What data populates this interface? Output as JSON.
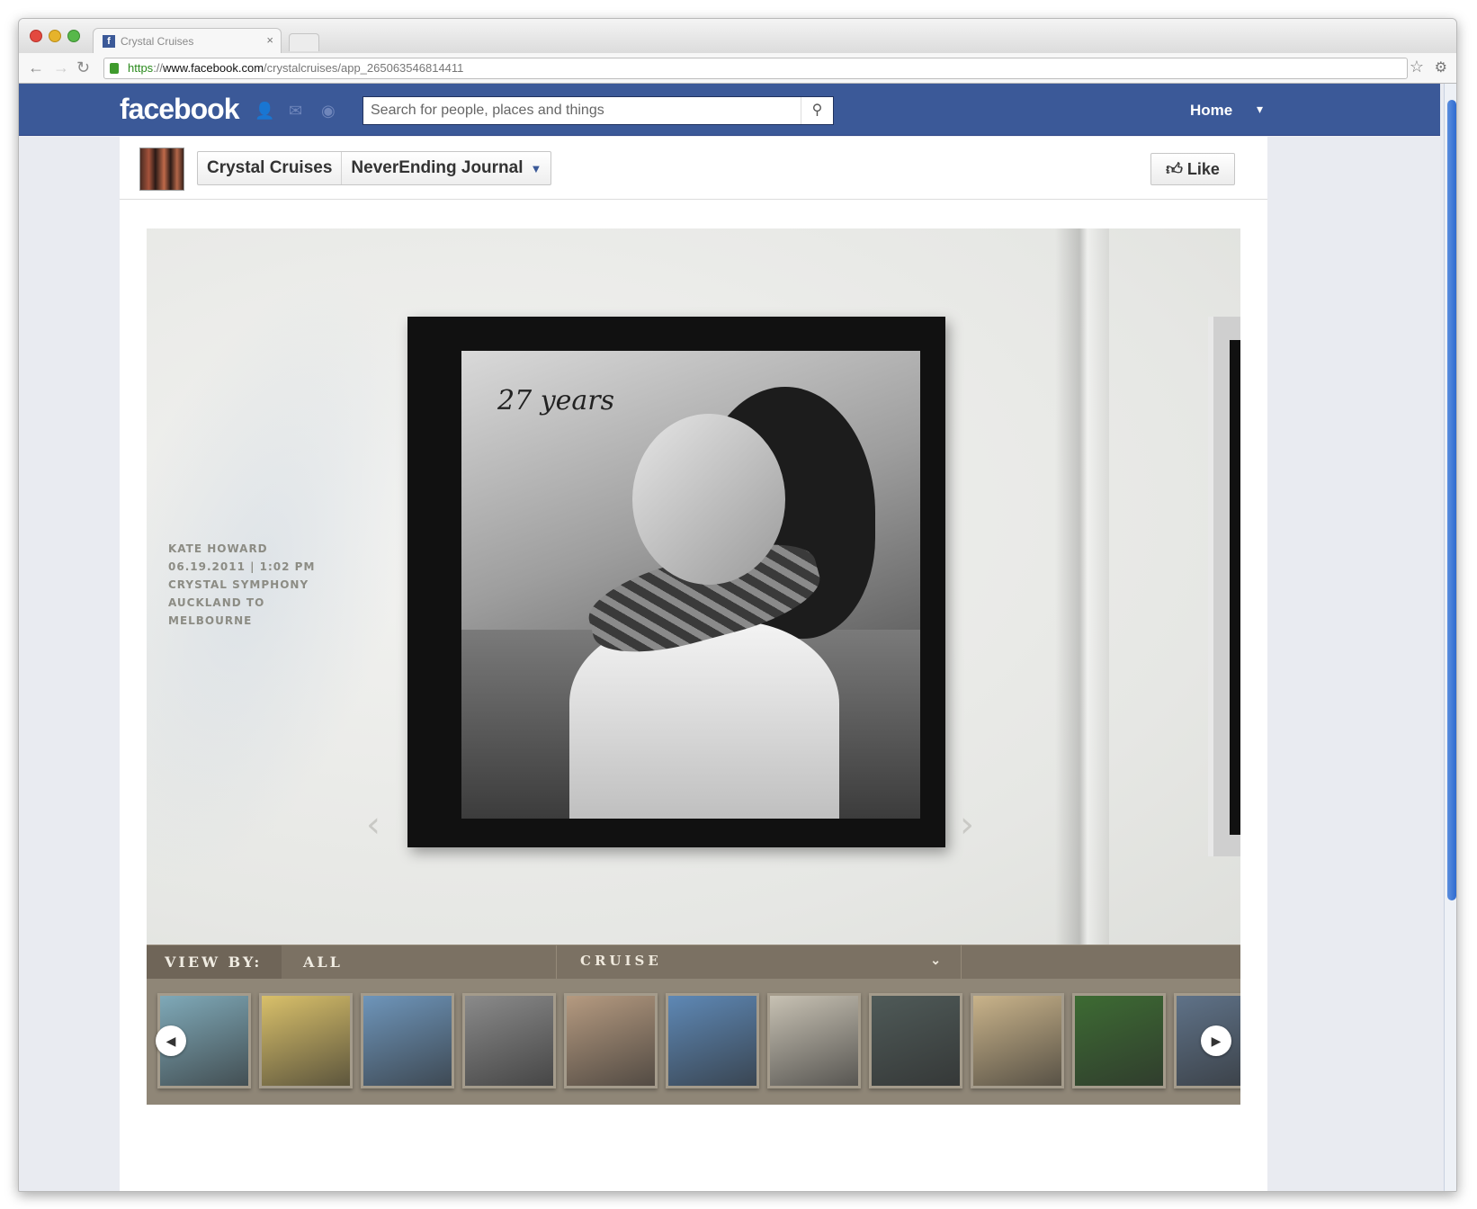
{
  "browser": {
    "tab_title": "Crystal Cruises",
    "tab_close": "×",
    "url_https": "https",
    "url_sep": "://",
    "url_domain": "www.facebook.com",
    "url_path": "/crystalcruises/app_265063546814411",
    "back": "←",
    "forward": "→",
    "reload": "↻",
    "star": "☆",
    "wrench": "🔧"
  },
  "facebook": {
    "logo": "facebook",
    "search_placeholder": "Search for people, places and things",
    "home": "Home",
    "caret": "▾"
  },
  "page": {
    "name": "Crystal Cruises",
    "app": "NeverEnding Journal",
    "like": "Like"
  },
  "journal": {
    "caption_lines": [
      "KATE HOWARD",
      "06.19.2011 | 1:02 PM",
      "CRYSTAL SYMPHONY",
      "AUCKLAND TO",
      "MELBOURNE"
    ],
    "photo_script": "27 years",
    "prev_arrow": "‹",
    "next_arrow": "›"
  },
  "viewby": {
    "label": "VIEW BY:",
    "all": "ALL",
    "cruise": "CRUISE",
    "chevron": "⌄"
  },
  "thumbnails": {
    "left_arrow": "◀",
    "right_arrow": "▶",
    "colors": [
      "#7fa9b8",
      "#d9c06a",
      "#6e95ba",
      "#8a8a8a",
      "#b59a80",
      "#5e88b5",
      "#c7c1b3",
      "#4f5a58",
      "#c9b38a",
      "#3d6b33",
      "#5f7288"
    ]
  }
}
